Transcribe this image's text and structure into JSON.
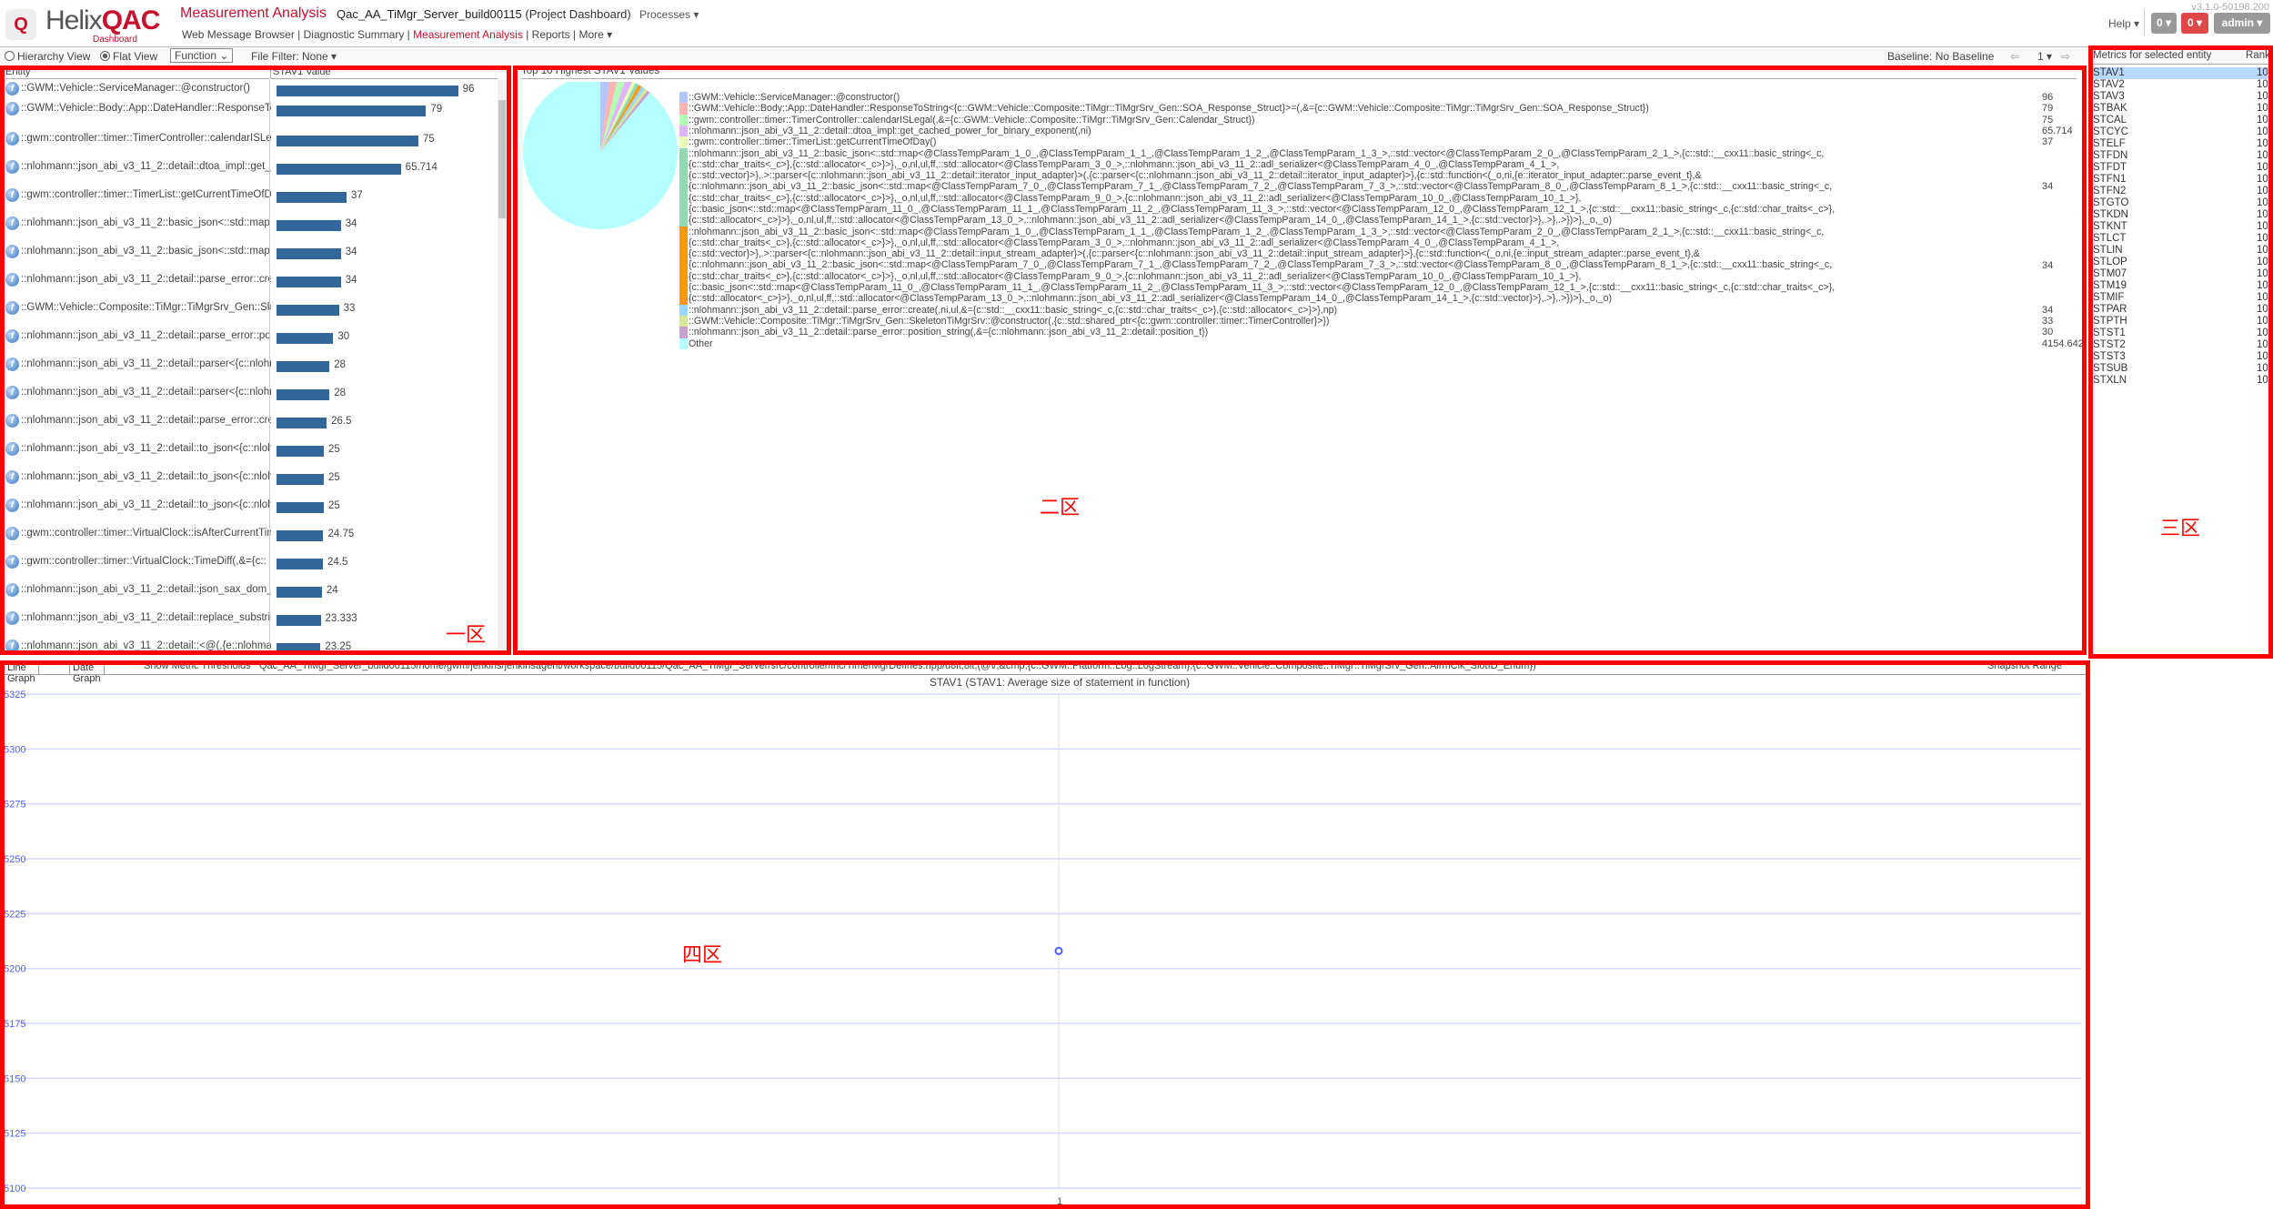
{
  "header": {
    "logo_text": "HelixQAC",
    "logo_sub": "Dashboard",
    "app_title": "Measurement Analysis",
    "project": "Qac_AA_TiMgr_Server_build00115",
    "project_suffix": "(Project Dashboard)",
    "processes": "Processes ▾",
    "version": "v3.1.0-50198.200",
    "help": "Help ▾",
    "btn1": "0 ▾",
    "btn2": "0 ▾",
    "user": "admin ▾",
    "nav": [
      "Web Message Browser",
      "Diagnostic Summary",
      "Measurement Analysis",
      "Reports",
      "More ▾"
    ],
    "nav_active": 2
  },
  "toolbar": {
    "hierarchy": "Hierarchy View",
    "flat": "Flat View",
    "selected_view": "flat",
    "level": "Function ⌄",
    "file_filter": "File Filter: None ▾",
    "baseline": "Baseline: No Baseline",
    "page": "1 ▾"
  },
  "entity_panel": {
    "col_entity": "Entity",
    "col_value": "STAV1 Value",
    "bar_color": "#336699",
    "rows": [
      {
        "name": "::GWM::Vehicle::ServiceManager::@constructor()",
        "value": 96,
        "label": "96"
      },
      {
        "name": "::GWM::Vehicle::Body::App::DateHandler::ResponseToString",
        "value": 79,
        "label": "79"
      },
      {
        "name": "::gwm::controller::timer::TimerController::calendarISLegal",
        "value": 75,
        "label": "75"
      },
      {
        "name": "::nlohmann::json_abi_v3_11_2::detail::dtoa_impl::get_cached",
        "value": 65.714,
        "label": "65.714"
      },
      {
        "name": "::gwm::controller::timer::TimerList::getCurrentTimeOfDay",
        "value": 37,
        "label": "37"
      },
      {
        "name": "::nlohmann::json_abi_v3_11_2::basic_json<::std::map",
        "value": 34,
        "label": "34"
      },
      {
        "name": "::nlohmann::json_abi_v3_11_2::basic_json<::std::map",
        "value": 34,
        "label": "34"
      },
      {
        "name": "::nlohmann::json_abi_v3_11_2::detail::parse_error::create",
        "value": 34,
        "label": "34"
      },
      {
        "name": "::GWM::Vehicle::Composite::TiMgr::TiMgrSrv_Gen::Skeleton",
        "value": 33,
        "label": "33"
      },
      {
        "name": "::nlohmann::json_abi_v3_11_2::detail::parse_error::position",
        "value": 30,
        "label": "30"
      },
      {
        "name": "::nlohmann::json_abi_v3_11_2::detail::parser<{c::nlohmann",
        "value": 28,
        "label": "28"
      },
      {
        "name": "::nlohmann::json_abi_v3_11_2::detail::parser<{c::nlohmann",
        "value": 28,
        "label": "28"
      },
      {
        "name": "::nlohmann::json_abi_v3_11_2::detail::parse_error::create",
        "value": 26.5,
        "label": "26.5"
      },
      {
        "name": "::nlohmann::json_abi_v3_11_2::detail::to_json<{c::nlohmann",
        "value": 25,
        "label": "25"
      },
      {
        "name": "::nlohmann::json_abi_v3_11_2::detail::to_json<{c::nlohmann",
        "value": 25,
        "label": "25"
      },
      {
        "name": "::nlohmann::json_abi_v3_11_2::detail::to_json<{c::nlohmann",
        "value": 25,
        "label": "25"
      },
      {
        "name": "::gwm::controller::timer::VirtualClock::isAfterCurrentTime",
        "value": 24.75,
        "label": "24.75"
      },
      {
        "name": "::gwm::controller::timer::VirtualClock::TimeDiff(,&={c::",
        "value": 24.5,
        "label": "24.5"
      },
      {
        "name": "::nlohmann::json_abi_v3_11_2::detail::json_sax_dom_parser",
        "value": 24,
        "label": "24"
      },
      {
        "name": "::nlohmann::json_abi_v3_11_2::detail::replace_substring",
        "value": 23.333,
        "label": "23.333"
      },
      {
        "name": "::nlohmann::json_abi_v3_11_2::detail::<@(,{e::nlohmann",
        "value": 23.25,
        "label": "23.25"
      }
    ]
  },
  "pie_panel": {
    "title": "Top 10 Highest STAV1 Values",
    "entries": [
      {
        "lines": [
          "::GWM::Vehicle::ServiceManager::@constructor()"
        ],
        "value": 96,
        "label": "96",
        "color": "#b3c6ff"
      },
      {
        "lines": [
          "::GWM::Vehicle::Body::App::DateHandler::ResponseToString<{c::GWM::Vehicle::Composite::TiMgr::TiMgrSrv_Gen::SOA_Response_Struct}>=(,&={c::GWM::Vehicle::Composite::TiMgr::TiMgrSrv_Gen::SOA_Response_Struct})"
        ],
        "value": 79,
        "label": "79",
        "color": "#ffb3b3"
      },
      {
        "lines": [
          "::gwm::controller::timer::TimerController::calendarISLegal(,&={c::GWM::Vehicle::Composite::TiMgr::TiMgrSrv_Gen::Calendar_Struct})"
        ],
        "value": 75,
        "label": "75",
        "color": "#b3ffb3"
      },
      {
        "lines": [
          "::nlohmann::json_abi_v3_11_2::detail::dtoa_impl::get_cached_power_for_binary_exponent(,ni)"
        ],
        "value": 65.714,
        "label": "65.714",
        "color": "#e0b3ff"
      },
      {
        "lines": [
          "::gwm::controller::timer::TimerList::getCurrentTimeOfDay()"
        ],
        "value": 37,
        "label": "37",
        "color": "#e6ffb3"
      },
      {
        "lines": [
          "::nlohmann::json_abi_v3_11_2::basic_json<::std::map<@ClassTempParam_1_0_,@ClassTempParam_1_1_,@ClassTempParam_1_2_,@ClassTempParam_1_3_>,::std::vector<@ClassTempParam_2_0_,@ClassTempParam_2_1_>,{c::std::__cxx11::basic_string<_c,",
          "{c::std::char_traits<_c>},{c::std::allocator<_c>}>},_o,nl,ul,ff,::std::allocator<@ClassTempParam_3_0_>,::nlohmann::json_abi_v3_11_2::adl_serializer<@ClassTempParam_4_0_,@ClassTempParam_4_1_>,",
          "{c::std::vector}>},.>::parser<{c::nlohmann::json_abi_v3_11_2::detail::iterator_input_adapter}>(,{c::parser<{c::nlohmann::json_abi_v3_11_2::detail::iterator_input_adapter}>},{c::std::function<(_o,ni,{e::iterator_input_adapter::parse_event_t},&",
          "{c::nlohmann::json_abi_v3_11_2::basic_json<::std::map<@ClassTempParam_7_0_,@ClassTempParam_7_1_,@ClassTempParam_7_2_,@ClassTempParam_7_3_>,::std::vector<@ClassTempParam_8_0_,@ClassTempParam_8_1_>,{c::std::__cxx11::basic_string<_c,",
          "{c::std::char_traits<_c>},{c::std::allocator<_c>}>},_o,nl,ul,ff,::std::allocator<@ClassTempParam_9_0_>,{c::nlohmann::json_abi_v3_11_2::adl_serializer<@ClassTempParam_10_0_,@ClassTempParam_10_1_>},",
          "{c::basic_json<::std::map<@ClassTempParam_11_0_,@ClassTempParam_11_1_,@ClassTempParam_11_2_,@ClassTempParam_11_3_>,::std::vector<@ClassTempParam_12_0_,@ClassTempParam_12_1_>,{c::std::__cxx11::basic_string<_c,{c::std::char_traits<_c>},",
          "{c::std::allocator<_c>}>},_o,nl,ul,ff,::std::allocator<@ClassTempParam_13_0_>,::nlohmann::json_abi_v3_11_2::adl_serializer<@ClassTempParam_14_0_,@ClassTempParam_14_1_>,{c::std::vector}>},.>},.>})>},_o,_o)"
        ],
        "value": 34,
        "label": "34",
        "color": "#8fd9b3"
      },
      {
        "lines": [
          "::nlohmann::json_abi_v3_11_2::basic_json<::std::map<@ClassTempParam_1_0_,@ClassTempParam_1_1_,@ClassTempParam_1_2_,@ClassTempParam_1_3_>,::std::vector<@ClassTempParam_2_0_,@ClassTempParam_2_1_>,{c::std::__cxx11::basic_string<_c,",
          "{c::std::char_traits<_c>},{c::std::allocator<_c>}>},_o,nl,ul,ff,::std::allocator<@ClassTempParam_3_0_>,::nlohmann::json_abi_v3_11_2::adl_serializer<@ClassTempParam_4_0_,@ClassTempParam_4_1_>,",
          "{c::std::vector}>},.>::parser<{c::nlohmann::json_abi_v3_11_2::detail::input_stream_adapter}>(,{c::parser<{c::nlohmann::json_abi_v3_11_2::detail::input_stream_adapter}>},{c::std::function<(_o,ni,{e::input_stream_adapter::parse_event_t},&",
          "{c::nlohmann::json_abi_v3_11_2::basic_json<::std::map<@ClassTempParam_7_0_,@ClassTempParam_7_1_,@ClassTempParam_7_2_,@ClassTempParam_7_3_>,::std::vector<@ClassTempParam_8_0_,@ClassTempParam_8_1_>,{c::std::__cxx11::basic_string<_c,",
          "{c::std::char_traits<_c>},{c::std::allocator<_c>}>},_o,nl,ul,ff,::std::allocator<@ClassTempParam_9_0_>,{c::nlohmann::json_abi_v3_11_2::adl_serializer<@ClassTempParam_10_0_,@ClassTempParam_10_1_>},",
          "{c::basic_json<::std::map<@ClassTempParam_11_0_,@ClassTempParam_11_1_,@ClassTempParam_11_2_,@ClassTempParam_11_3_>,::std::vector<@ClassTempParam_12_0_,@ClassTempParam_12_1_>,{c::std::__cxx11::basic_string<_c,{c::std::char_traits<_c>},",
          "{c::std::allocator<_c>}>},_o,nl,ul,ff,::std::allocator<@ClassTempParam_13_0_>,::nlohmann::json_abi_v3_11_2::adl_serializer<@ClassTempParam_14_0_,@ClassTempParam_14_1_>,{c::std::vector}>},.>},.>})>},_o,_o)"
        ],
        "value": 34,
        "label": "34",
        "color": "#ff9900"
      },
      {
        "lines": [
          "::nlohmann::json_abi_v3_11_2::detail::parse_error::create(,ni,ul,&={c::std::__cxx11::basic_string<_c,{c::std::char_traits<_c>},{c::std::allocator<_c>}>},np)"
        ],
        "value": 34,
        "label": "34",
        "color": "#99d6ff"
      },
      {
        "lines": [
          "::GWM::Vehicle::Composite::TiMgr::TiMgrSrv_Gen::SkeletonTiMgrSrv::@constructor(,{c::std::shared_ptr<{c::gwm::controller::timer::TimerController}>})"
        ],
        "value": 33,
        "label": "33",
        "color": "#d6e699"
      },
      {
        "lines": [
          "::nlohmann::json_abi_v3_11_2::detail::parse_error::position_string(,&={c::nlohmann::json_abi_v3_11_2::detail::position_t})"
        ],
        "value": 30,
        "label": "30",
        "color": "#c8a0d0"
      },
      {
        "lines": [
          "Other"
        ],
        "value": 4154.642,
        "label": "4154.642",
        "color": "#b3ffff"
      }
    ]
  },
  "metrics_panel": {
    "col_metric": "Metrics for selected entity",
    "col_rank": "Rank",
    "selected": 0,
    "rows": [
      {
        "metric": "STAV1",
        "rank": "10"
      },
      {
        "metric": "STAV2",
        "rank": "10"
      },
      {
        "metric": "STAV3",
        "rank": "10"
      },
      {
        "metric": "STBAK",
        "rank": "10"
      },
      {
        "metric": "STCAL",
        "rank": "10"
      },
      {
        "metric": "STCYC",
        "rank": "10"
      },
      {
        "metric": "STELF",
        "rank": "10"
      },
      {
        "metric": "STFDN",
        "rank": "10"
      },
      {
        "metric": "STFDT",
        "rank": "10"
      },
      {
        "metric": "STFN1",
        "rank": "10"
      },
      {
        "metric": "STFN2",
        "rank": "10"
      },
      {
        "metric": "STGTO",
        "rank": "10"
      },
      {
        "metric": "STKDN",
        "rank": "10"
      },
      {
        "metric": "STKNT",
        "rank": "10"
      },
      {
        "metric": "STLCT",
        "rank": "10"
      },
      {
        "metric": "STLIN",
        "rank": "10"
      },
      {
        "metric": "STLOP",
        "rank": "10"
      },
      {
        "metric": "STM07",
        "rank": "10"
      },
      {
        "metric": "STM19",
        "rank": "10"
      },
      {
        "metric": "STMIF",
        "rank": "10"
      },
      {
        "metric": "STPAR",
        "rank": "10"
      },
      {
        "metric": "STPTH",
        "rank": "10"
      },
      {
        "metric": "STST1",
        "rank": "10"
      },
      {
        "metric": "STST2",
        "rank": "10"
      },
      {
        "metric": "STST3",
        "rank": "10"
      },
      {
        "metric": "STSUB",
        "rank": "10"
      },
      {
        "metric": "STXLN",
        "rank": "10"
      }
    ]
  },
  "graph_panel": {
    "tabs": [
      "Line Graph",
      "Date Graph"
    ],
    "active_tab": 0,
    "show_thresholds": "Show Metric Thresholds",
    "entity_path": "Qac_AA_TiMgr_Server_build00115/home/gwm/jenkins/jenkinsagent/workspace/build00115/Qac_AA_TiMgr_Server/src/controller/inc/TimerMgrDefines.hpp/u8lt;8lt;(@\\/,&cmp;{c::GWM::Platform::Log::LogStream},{c::GWM::Vehicle::Composite::TiMgr::TiMgrSrv_Gen::AlrmClk_SlotID_Enum})",
    "snapshot_range": "Snapshot Range"
  },
  "chart_data": {
    "type": "line",
    "title": "STAV1 (STAV1: Average size of statement in function)",
    "x": [
      1
    ],
    "values": [
      5208
    ],
    "x_ticks": [
      "1"
    ],
    "ylim": [
      5100,
      5325
    ],
    "y_ticks": [
      5325,
      5300,
      5275,
      5250,
      5225,
      5200,
      5175,
      5150,
      5125,
      5100
    ],
    "grid": true,
    "color": "#4d5fff"
  },
  "annotations": {
    "zone1": "一区",
    "zone2": "二区",
    "zone3": "三区",
    "zone4": "四区",
    "color": "#ff0000"
  }
}
